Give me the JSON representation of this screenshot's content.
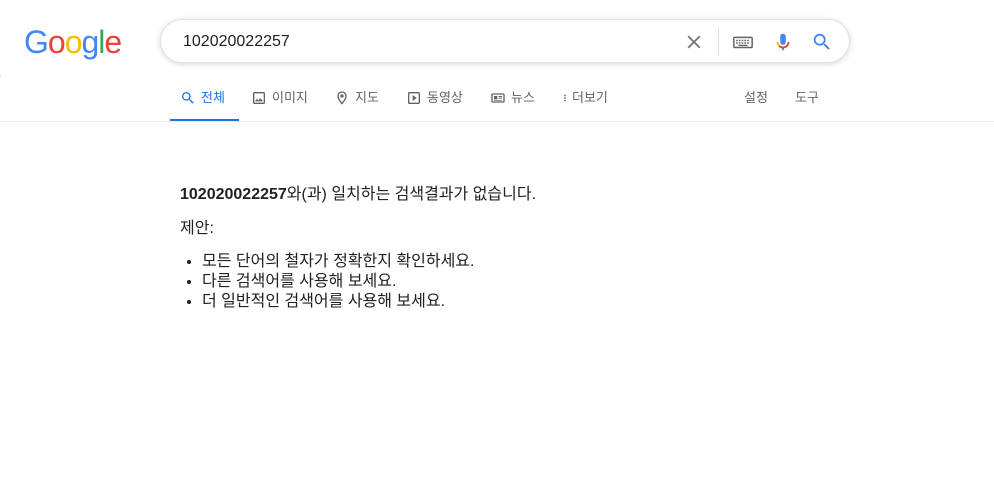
{
  "logo": {
    "letters": [
      "G",
      "o",
      "o",
      "g",
      "l",
      "e"
    ],
    "colors": [
      "#4285F4",
      "#EA4335",
      "#FBBC05",
      "#4285F4",
      "#34A853",
      "#EA4335"
    ]
  },
  "search": {
    "query": "102020022257",
    "icons": {
      "clear": "close-icon",
      "keyboard": "keyboard-icon",
      "voice": "microphone-icon",
      "submit": "search-icon"
    }
  },
  "tabs": [
    {
      "label": "전체",
      "icon": "search-icon",
      "active": true
    },
    {
      "label": "이미지",
      "icon": "image-icon",
      "active": false
    },
    {
      "label": "지도",
      "icon": "map-pin-icon",
      "active": false
    },
    {
      "label": "동영상",
      "icon": "video-icon",
      "active": false
    },
    {
      "label": "뉴스",
      "icon": "news-icon",
      "active": false
    },
    {
      "label": "더보기",
      "icon": "more-vert-icon",
      "active": false
    }
  ],
  "tools": {
    "settings": "설정",
    "tools": "도구"
  },
  "results": {
    "query_bold": "102020022257",
    "no_result_suffix": "와(과) 일치하는 검색결과가 없습니다.",
    "suggestions_title": "제안:",
    "suggestions": [
      "모든 단어의 철자가 정확한지 확인하세요.",
      "다른 검색어를 사용해 보세요.",
      "더 일반적인 검색어를 사용해 보세요."
    ]
  },
  "colors": {
    "accent": "#1a73e8",
    "text": "#202124",
    "muted": "#5f6368"
  }
}
